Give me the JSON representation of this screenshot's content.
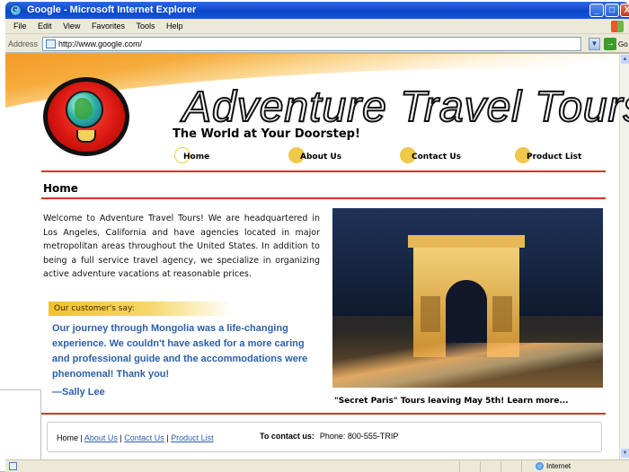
{
  "window": {
    "title": "Google - Microsoft Internet Explorer",
    "buttons": {
      "minimize": "_",
      "maximize": "□",
      "close": "X"
    }
  },
  "menu": [
    "File",
    "Edit",
    "View",
    "Favorites",
    "Tools",
    "Help"
  ],
  "address": {
    "label": "Address",
    "url": "http://www.google.com/",
    "go_label": "Go"
  },
  "site": {
    "brand": "Adventure Travel Tours",
    "tagline": "The World at Your Doorstep!",
    "nav": [
      "Home",
      "About Us",
      "Contact Us",
      "Product List"
    ],
    "page_heading": "Home",
    "intro": "Welcome to Adventure Travel Tours! We are headquartered in Los Angeles, California and have agencies located in major metropolitan areas throughout the United States. In addition to being a full service travel agency, we specialize in organizing active adventure vacations at reasonable prices.",
    "testimonial": {
      "label": "Our customer's say:",
      "quote": "Our journey through Mongolia was a life-changing experience. We couldn't have asked for a more caring and professional guide and the accommodations were phenomenal! Thank you!",
      "author": "—Sally Lee"
    },
    "photo_caption": "\"Secret Paris\"  Tours leaving May 5th! Learn more...",
    "footer": {
      "home": "Home",
      "sep": " | ",
      "about": "About Us",
      "contact": "Contact Us",
      "products": "Product List",
      "contact_label": "To contact us:",
      "phone": "Phone: 800-555-TRIP"
    }
  },
  "status": {
    "zone": "Internet"
  },
  "colors": {
    "accent_red": "#d93326",
    "link_blue": "#2d5fa8",
    "nav_dot": "#f0c94b",
    "title_blue": "#0a47c9"
  }
}
